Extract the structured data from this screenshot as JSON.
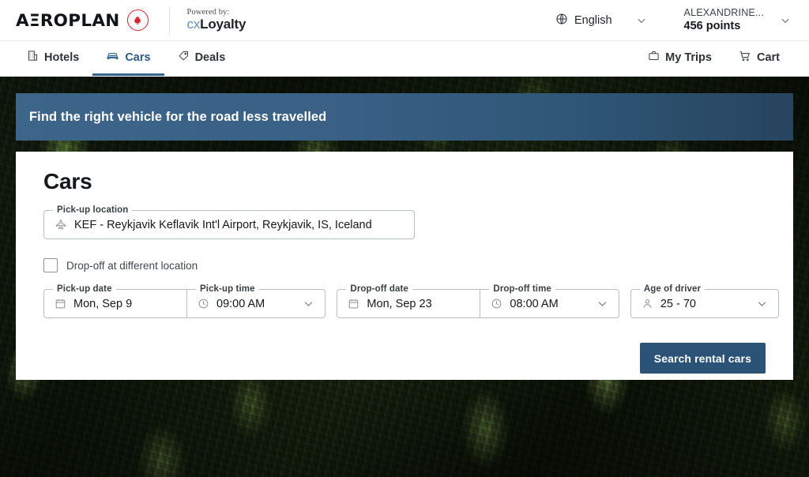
{
  "header": {
    "brand": {
      "wordmark": "AΞROPLAN",
      "maple_leaf_icon": "maple-leaf-icon",
      "powered_by_label": "Powered by:",
      "partner_cx": "cx",
      "partner_loyalty": "Loyalty"
    },
    "language": {
      "icon": "globe-icon",
      "label": "English",
      "chevron": "chevron-down-icon"
    },
    "account": {
      "name": "ALEXANDRINE...",
      "points": "456 points",
      "chevron": "chevron-down-icon"
    },
    "nav": {
      "left_items": [
        {
          "label": "Hotels",
          "icon": "hotel-building-icon",
          "active": false
        },
        {
          "label": "Cars",
          "icon": "car-icon",
          "active": true
        },
        {
          "label": "Deals",
          "icon": "tag-icon",
          "active": false
        }
      ],
      "right_items": [
        {
          "label": "My Trips",
          "icon": "briefcase-icon"
        },
        {
          "label": "Cart",
          "icon": "shopping-cart-icon"
        }
      ]
    }
  },
  "banner": {
    "title": "Find the right vehicle for the road less travelled",
    "bg_color_start": "#3c6589",
    "bg_color_end": "#27445f"
  },
  "search_card": {
    "title": "Cars",
    "pickup_location": {
      "label": "Pick-up location",
      "value": "KEF - Reykjavik Keflavik Int'l Airport, Reykjavik, IS, Iceland",
      "icon": "airplane-icon"
    },
    "dropoff_checkbox": {
      "label": "Drop-off at different location",
      "checked": false
    },
    "pickup_date": {
      "label": "Pick-up date",
      "value": "Mon, Sep 9",
      "icon": "calendar-icon"
    },
    "pickup_time": {
      "label": "Pick-up time",
      "value": "09:00 AM",
      "icon": "clock-icon",
      "chevron": "chevron-down-icon"
    },
    "dropoff_date": {
      "label": "Drop-off date",
      "value": "Mon, Sep 23",
      "icon": "calendar-icon"
    },
    "dropoff_time": {
      "label": "Drop-off time",
      "value": "08:00 AM",
      "icon": "clock-icon",
      "chevron": "chevron-down-icon"
    },
    "age_of_driver": {
      "label": "Age of driver",
      "value": "25 - 70",
      "icon": "person-icon",
      "chevron": "chevron-down-icon"
    },
    "search_button": {
      "label": "Search rental cars",
      "color": "#2b5277"
    }
  }
}
